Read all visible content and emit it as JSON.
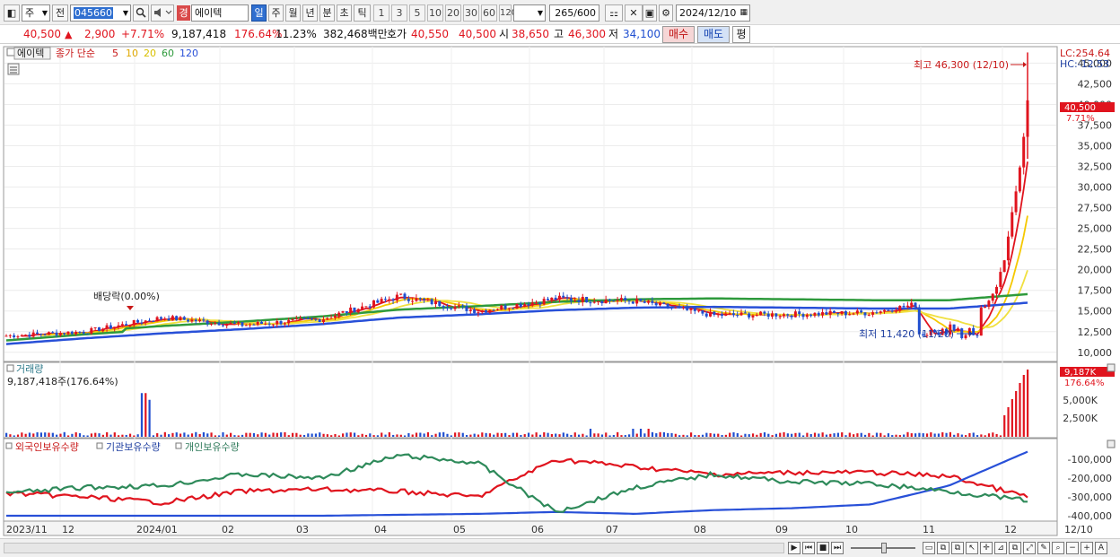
{
  "toolbar": {
    "market_select": "주",
    "prev_btn": "전",
    "stock_code": "045660",
    "grade_badge": "경",
    "stock_name": "에이텍",
    "period_buttons": [
      "일",
      "주",
      "월",
      "년",
      "분",
      "초",
      "틱"
    ],
    "active_period": "일",
    "interval_buttons": [
      "1",
      "3",
      "5",
      "10",
      "20",
      "30",
      "60",
      "120"
    ],
    "count": "265",
    "count_max": "/600",
    "date": "2024/12/10"
  },
  "quote": {
    "price": "40,500",
    "arrow": "▲",
    "change": "2,900",
    "change_pct": "+7.71%",
    "volume": "9,187,418",
    "volume_ratio": "176.64%",
    "turnover": "11.23%",
    "trade_value": "382,468백만",
    "bid_label": "호가",
    "ask_price": "40,550",
    "bid_price": "40,500",
    "open_label": "시",
    "open": "38,650",
    "high_label": "고",
    "high": "46,300",
    "low_label": "저",
    "low": "34,100",
    "buy_label": "매수",
    "sell_label": "매도",
    "eval_label": "평"
  },
  "price_panel": {
    "legend_name": "에이텍",
    "legend_ma_prefix": "종가 단순",
    "ma_periods": [
      "5",
      "10",
      "20",
      "60",
      "120"
    ],
    "ma_colors": [
      "#e0141e",
      "#f5c800",
      "#f0e040",
      "#2e9a3c",
      "#2850d8"
    ],
    "lc": "LC:254.64",
    "hc": "HC:-12.53",
    "last_price_tag": "40,500",
    "last_pct_tag": "7.71%",
    "high_annotation": "최고 46,300 (12/10)",
    "low_annotation": "최저 11,420 (11/20)",
    "dividend_annotation": "배당락(0.00%)",
    "y_ticks": [
      "45,000",
      "42,500",
      "40,000",
      "37,500",
      "35,000",
      "32,500",
      "30,000",
      "27,500",
      "25,000",
      "22,500",
      "20,000",
      "17,500",
      "15,000",
      "12,500",
      "10,000"
    ]
  },
  "volume_panel": {
    "title": "거래량",
    "value_text": "9,187,418주(176.64%)",
    "tag_value": "9,187K",
    "tag_pct": "176.64%",
    "y_ticks": [
      "5,000K",
      "2,500K"
    ]
  },
  "holdings_panel": {
    "series": [
      {
        "name": "외국인보유수량",
        "color": "#e0141e"
      },
      {
        "name": "기관보유수량",
        "color": "#2850d8"
      },
      {
        "name": "개인보유수량",
        "color": "#2e8a5a"
      }
    ],
    "y_ticks": [
      "-100,000",
      "-200,000",
      "-300,000",
      "-400,000"
    ]
  },
  "x_axis": {
    "labels": [
      "2023/11",
      "12",
      "2024/01",
      "02",
      "03",
      "04",
      "05",
      "06",
      "07",
      "08",
      "09",
      "10",
      "11",
      "12",
      "12/10"
    ]
  },
  "chart_data": {
    "type": "candlestick",
    "title": "에이텍",
    "y_unit": "KRW",
    "ylim": [
      9000,
      47000
    ],
    "months": [
      "2023/11",
      "2023/12",
      "2024/01",
      "2024/02",
      "2024/03",
      "2024/04",
      "2024/05",
      "2024/06",
      "2024/07",
      "2024/08",
      "2024/09",
      "2024/10",
      "2024/11",
      "2024/12"
    ],
    "approx_close_by_month": [
      12000,
      12500,
      14200,
      13300,
      14000,
      16800,
      15000,
      16500,
      16200,
      14500,
      14600,
      14800,
      16500,
      40500
    ],
    "high": {
      "value": 46300,
      "date": "12/10"
    },
    "low": {
      "value": 11420,
      "date": "11/20"
    },
    "last": {
      "value": 40500,
      "change": 2900,
      "change_pct": 7.71
    },
    "ma_120_approx": [
      11000,
      11700,
      12300,
      12800,
      13400,
      14200,
      14600,
      15100,
      15400,
      15500,
      15400,
      15300,
      15300,
      16000
    ]
  }
}
